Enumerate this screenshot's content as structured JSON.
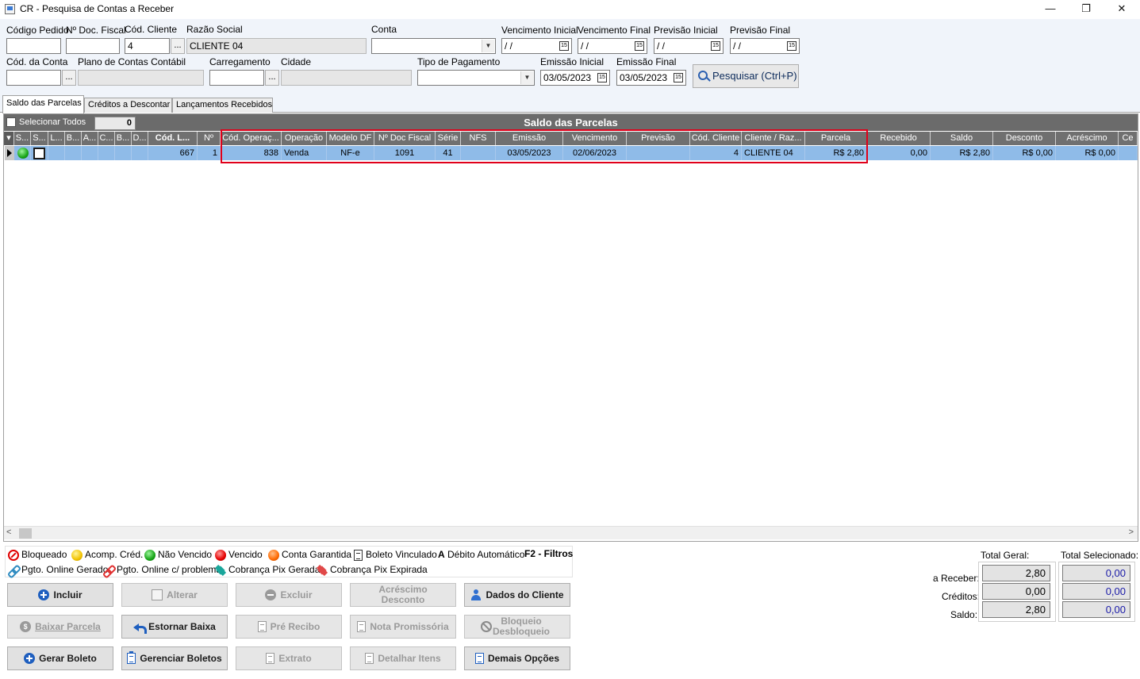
{
  "window": {
    "title": "CR - Pesquisa de Contas a Receber",
    "minimize": "—",
    "restore": "❐",
    "close": "✕"
  },
  "filters": {
    "codigo_pedido": {
      "label": "Código Pedido",
      "value": ""
    },
    "num_doc_fiscal": {
      "label": "Nº Doc. Fiscal",
      "value": ""
    },
    "cod_cliente": {
      "label": "Cód. Cliente",
      "value": "4"
    },
    "razao_social": {
      "label": "Razão Social",
      "value": "CLIENTE 04"
    },
    "conta": {
      "label": "Conta",
      "value": ""
    },
    "vencimento_inicial": {
      "label": "Vencimento Inicial",
      "value": " / /"
    },
    "vencimento_final": {
      "label": "Vencimento Final",
      "value": " / /"
    },
    "previsao_inicial": {
      "label": "Previsão Inicial",
      "value": " / /"
    },
    "previsao_final": {
      "label": "Previsão Final",
      "value": " / /"
    },
    "cod_conta": {
      "label": "Cód. da Conta",
      "value": ""
    },
    "plano_contas": {
      "label": "Plano de Contas Contábil",
      "value": ""
    },
    "carregamento": {
      "label": "Carregamento",
      "value": ""
    },
    "cidade": {
      "label": "Cidade",
      "value": ""
    },
    "tipo_pagamento": {
      "label": "Tipo de Pagamento",
      "value": ""
    },
    "emissao_inicial": {
      "label": "Emissão Inicial",
      "value": "03/05/2023"
    },
    "emissao_final": {
      "label": "Emissão Final",
      "value": "03/05/2023"
    },
    "dots": "...",
    "cal_glyph": "15",
    "search_button": "Pesquisar (Ctrl+P)"
  },
  "tabs": [
    {
      "label": "Saldo das Parcelas"
    },
    {
      "label": "Créditos a Descontar"
    },
    {
      "label": "Lançamentos Recebidos"
    }
  ],
  "grid": {
    "title": "Saldo das Parcelas",
    "select_all": "Selecionar Todos",
    "selected_count": "0",
    "columns": [
      "S...",
      "S...",
      "L...",
      "B...",
      "A...",
      "C...",
      "B...",
      "D...",
      "Cód. L...",
      "Nº",
      "Cód. Operaç...",
      "Operação",
      "Modelo DF",
      "Nº Doc Fiscal",
      "Série",
      "NFS",
      "Emissão",
      "Vencimento",
      "Previsão",
      "Cód. Cliente",
      "Cliente / Raz...",
      "Parcela",
      "Recebido",
      "Saldo",
      "Desconto",
      "Acréscimo",
      "Ce"
    ],
    "rows": [
      [
        "",
        "",
        "",
        "",
        "",
        "",
        "",
        "",
        "667",
        "1",
        "838",
        "Venda",
        "NF-e",
        "1091",
        "41",
        "",
        "03/05/2023",
        "02/06/2023",
        "",
        "4",
        "CLIENTE 04",
        "R$ 2,80",
        "0,00",
        "R$ 2,80",
        "R$ 0,00",
        "R$ 0,00",
        ""
      ]
    ],
    "scroll_left": "<",
    "scroll_right": ">"
  },
  "legend": {
    "bloqueado": "Bloqueado",
    "acomp_cred": "Acomp. Créd.",
    "nao_vencido": "Não Vencido",
    "vencido": "Vencido",
    "conta_garantida": "Conta Garantida",
    "boleto_vinculado": "Boleto Vinculado",
    "debito_automatico_letter": "A",
    "debito_automatico": "Débito Automático",
    "filtros": "F2 - Filtros",
    "pgto_online_gerado": "Pgto. Online Gerado",
    "pgto_online_problema": "Pgto. Online c/ problema",
    "cobranca_pix_gerada": "Cobrança Pix Gerada",
    "cobranca_pix_expirada": "Cobrança Pix Expirada"
  },
  "actions": {
    "incluir": "Incluir",
    "alterar": "Alterar",
    "excluir": "Excluir",
    "acrescimo_l1": "Acréscimo",
    "acrescimo_l2": "Desconto",
    "dados_cliente": "Dados do Cliente",
    "baixar_parcela": "Baixar Parcela",
    "estornar_baixa": "Estornar Baixa",
    "pre_recibo": "Pré Recibo",
    "nota_promissoria": "Nota Promissória",
    "bloqueio_l1": "Bloqueio",
    "bloqueio_l2": "Desbloqueio",
    "gerar_boleto": "Gerar Boleto",
    "gerenciar_boletos": "Gerenciar Boletos",
    "extrato": "Extrato",
    "detalhar_itens": "Detalhar Itens",
    "demais_opcoes": "Demais Opções",
    "dollar_glyph": "$"
  },
  "totals": {
    "total_geral": "Total Geral:",
    "total_selecionado": "Total Selecionado:",
    "a_receber_label": "a Receber:",
    "creditos_label": "Créditos:",
    "saldo_label": "Saldo:",
    "geral_a_receber": "2,80",
    "geral_creditos": "0,00",
    "geral_saldo": "2,80",
    "sel_a_receber": "0,00",
    "sel_creditos": "0,00",
    "sel_saldo": "0,00"
  },
  "colors": {
    "row_selected": "#8fbbe8",
    "header": "#707070",
    "highlight": "#e0001a"
  }
}
